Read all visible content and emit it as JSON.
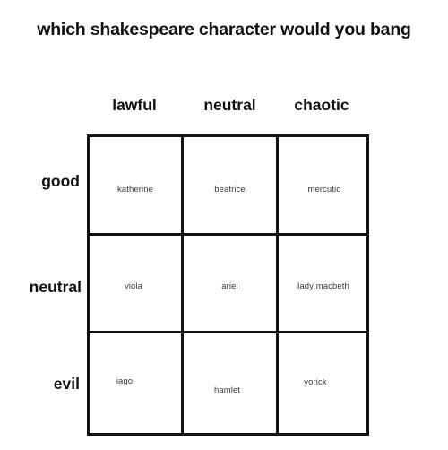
{
  "title": "which shakespeare character would you bang",
  "colors": {
    "background": "#ffffff",
    "grid_border": "#141414",
    "header_text": "#111111",
    "cell_text": "#3a3a3a"
  },
  "chart_data": {
    "type": "table",
    "title": "which shakespeare character would you bang",
    "columns": [
      "lawful",
      "neutral",
      "chaotic"
    ],
    "rows": [
      "good",
      "neutral",
      "evil"
    ],
    "cells": [
      [
        "katherine",
        "beatrice",
        "mercutio"
      ],
      [
        "viola",
        "ariel",
        "lady macbeth"
      ],
      [
        "iago",
        "hamlet",
        "yorick"
      ]
    ],
    "grid": true,
    "xlabel": "",
    "ylabel": ""
  },
  "grid": {
    "column_headers": [
      {
        "label": "lawful"
      },
      {
        "label": "neutral"
      },
      {
        "label": "chaotic"
      }
    ],
    "row_labels": [
      {
        "label": "good"
      },
      {
        "label": "neutral"
      },
      {
        "label": "evil"
      }
    ],
    "cells": [
      [
        {
          "name": "katherine"
        },
        {
          "name": "beatrice"
        },
        {
          "name": "mercutio"
        }
      ],
      [
        {
          "name": "viola"
        },
        {
          "name": "ariel"
        },
        {
          "name": "lady macbeth"
        }
      ],
      [
        {
          "name": "iago"
        },
        {
          "name": "hamlet"
        },
        {
          "name": "yorick"
        }
      ]
    ]
  }
}
